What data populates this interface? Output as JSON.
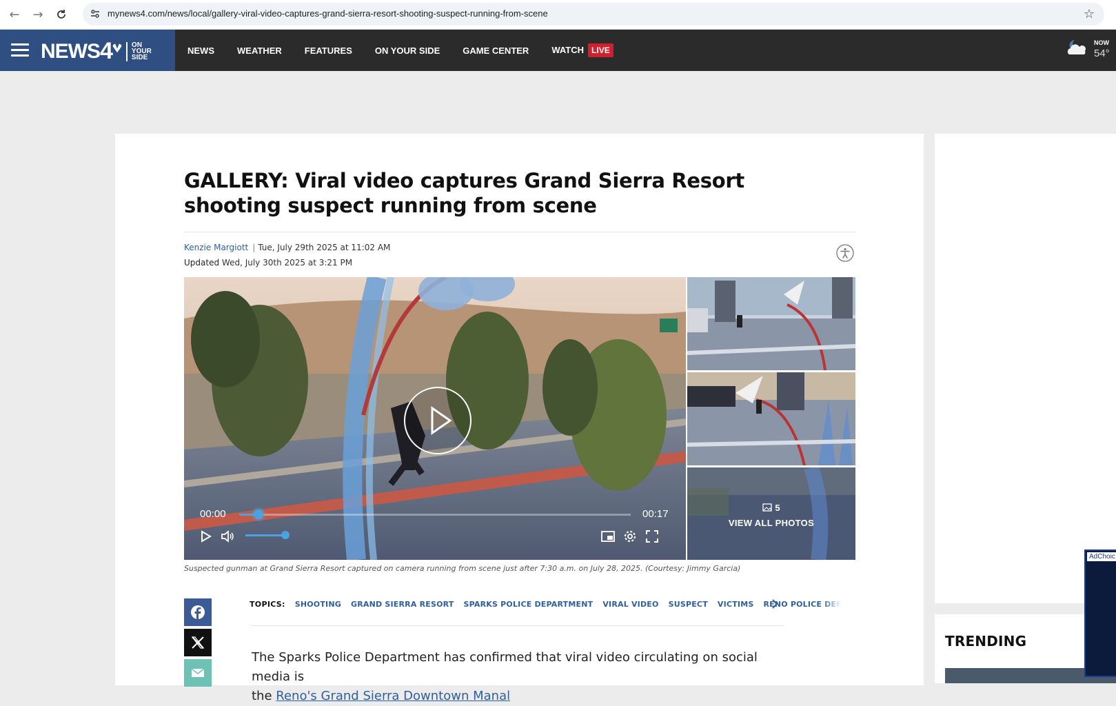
{
  "browser": {
    "url": "mynews4.com/news/local/gallery-viral-video-captures-grand-sierra-resort-shooting-suspect-running-from-scene"
  },
  "header": {
    "logo_text": "NEWS",
    "logo_number": "4",
    "logo_tag": [
      "ON",
      "YOUR",
      "SIDE"
    ],
    "nav": [
      "NEWS",
      "WEATHER",
      "FEATURES",
      "ON YOUR SIDE",
      "GAME CENTER",
      "WATCH"
    ],
    "live_badge": "LIVE",
    "weather": {
      "now_label": "NOW",
      "temp": "54°"
    }
  },
  "article": {
    "headline": "GALLERY: Viral video captures Grand Sierra Resort shooting suspect running from scene",
    "author": "Kenzie Margiott",
    "published": "Tue, July 29th 2025 at 11:02 AM",
    "updated_label": "Updated",
    "updated": "Wed, July 30th 2025 at 3:21 PM",
    "video": {
      "current_time": "00:00",
      "duration": "00:17",
      "progress_fraction": 0.05,
      "volume_fraction": 1.0
    },
    "gallery": {
      "photo_count": "5",
      "view_all_label": "VIEW ALL PHOTOS"
    },
    "caption": "Suspected gunman at Grand Sierra Resort captured on camera running from scene just after 7:30 a.m. on July 28, 2025. (Courtesy: Jimmy Garcia)",
    "topics_label": "TOPICS:",
    "topics": [
      "SHOOTING",
      "GRAND SIERRA RESORT",
      "SPARKS POLICE DEPARTMENT",
      "VIRAL VIDEO",
      "SUSPECT",
      "VICTIMS",
      "RENO POLICE DEF"
    ],
    "body_line1": "The Sparks Police Department has confirmed that viral video circulating on social media is",
    "body_line2_start": "the ",
    "body_link": "Reno's Grand Sierra Downtown Manal"
  },
  "rail": {
    "trending_title": "TRENDING",
    "ad_label": "AdChoic"
  },
  "colors": {
    "brand_blue": "#2f4f83",
    "header_dark": "#2b2b2b",
    "live_red": "#d0202e",
    "link_blue": "#2e5f9e",
    "progress_blue": "#4aa3e0"
  }
}
